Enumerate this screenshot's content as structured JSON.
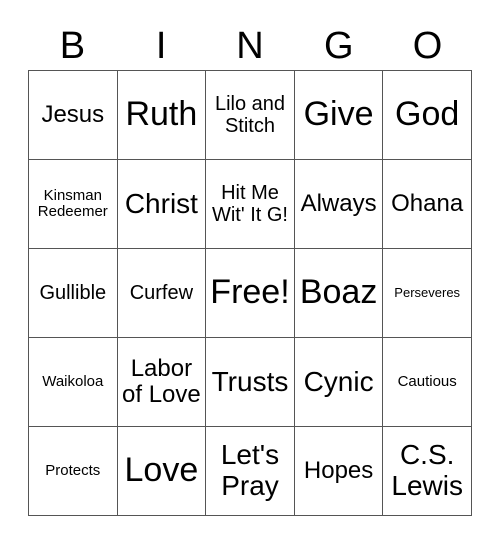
{
  "header": {
    "letters": [
      "B",
      "I",
      "N",
      "G",
      "O"
    ]
  },
  "grid": {
    "rows": [
      [
        {
          "text": "Jesus",
          "size": "fs-md"
        },
        {
          "text": "Ruth",
          "size": "fs-xl"
        },
        {
          "text": "Lilo and Stitch",
          "size": "fs-sm"
        },
        {
          "text": "Give",
          "size": "fs-xl"
        },
        {
          "text": "God",
          "size": "fs-xl"
        }
      ],
      [
        {
          "text": "Kinsman Redeemer",
          "size": "fs-xs"
        },
        {
          "text": "Christ",
          "size": "fs-lg"
        },
        {
          "text": "Hit Me Wit' It G!",
          "size": "fs-sm"
        },
        {
          "text": "Always",
          "size": "fs-md"
        },
        {
          "text": "Ohana",
          "size": "fs-md"
        }
      ],
      [
        {
          "text": "Gullible",
          "size": "fs-sm"
        },
        {
          "text": "Curfew",
          "size": "fs-sm"
        },
        {
          "text": "Free!",
          "size": "fs-xl"
        },
        {
          "text": "Boaz",
          "size": "fs-xl"
        },
        {
          "text": "Perseveres",
          "size": "fs-xxs"
        }
      ],
      [
        {
          "text": "Waikoloa",
          "size": "fs-xs"
        },
        {
          "text": "Labor of Love",
          "size": "fs-md"
        },
        {
          "text": "Trusts",
          "size": "fs-lg"
        },
        {
          "text": "Cynic",
          "size": "fs-lg"
        },
        {
          "text": "Cautious",
          "size": "fs-xs"
        }
      ],
      [
        {
          "text": "Protects",
          "size": "fs-xs"
        },
        {
          "text": "Love",
          "size": "fs-xl"
        },
        {
          "text": "Let's Pray",
          "size": "fs-lg"
        },
        {
          "text": "Hopes",
          "size": "fs-md"
        },
        {
          "text": "C.S. Lewis",
          "size": "fs-lg"
        }
      ]
    ]
  },
  "colors": {
    "grid_line": "#555555",
    "text": "#000000",
    "background": "#ffffff"
  }
}
